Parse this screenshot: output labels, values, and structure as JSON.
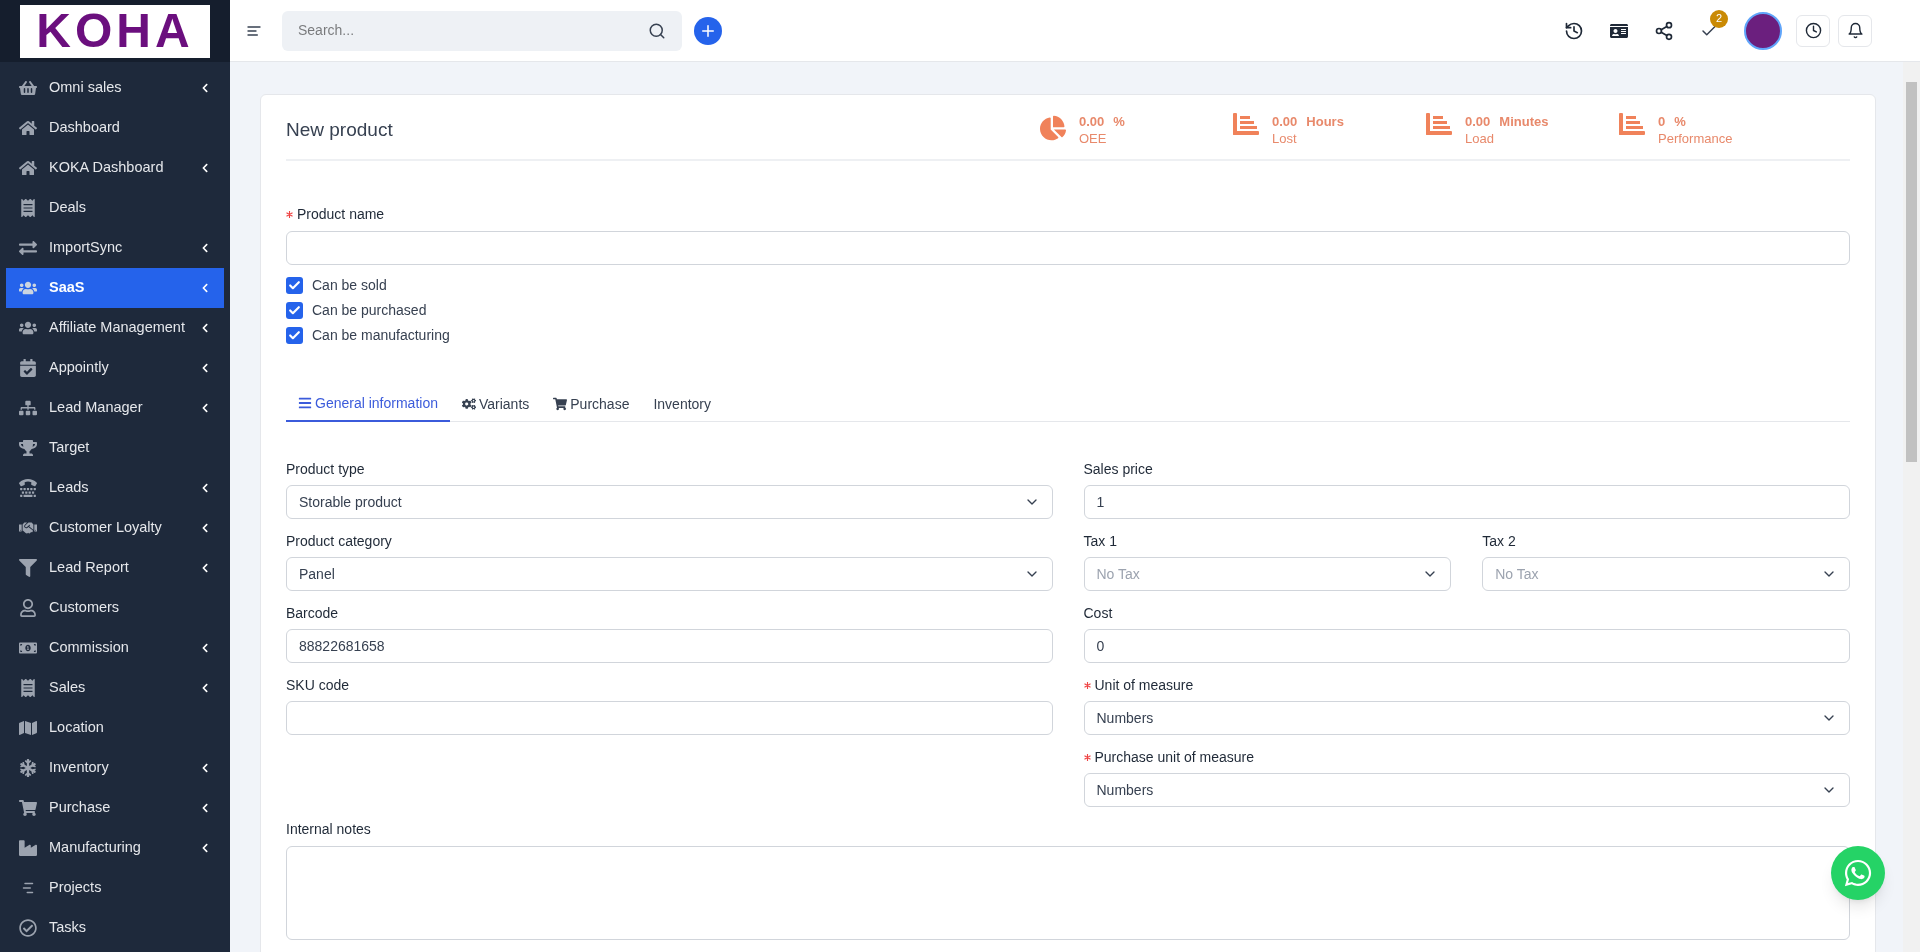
{
  "logo": {
    "text": "KOHA"
  },
  "sidebar": {
    "items": [
      {
        "label": "Omni sales",
        "selected": false,
        "has_submenu": true
      },
      {
        "label": "Dashboard",
        "selected": false,
        "has_submenu": false
      },
      {
        "label": "KOKA Dashboard",
        "selected": false,
        "has_submenu": true
      },
      {
        "label": "Deals",
        "selected": false,
        "has_submenu": false
      },
      {
        "label": "ImportSync",
        "selected": false,
        "has_submenu": true
      },
      {
        "label": "SaaS",
        "selected": true,
        "has_submenu": true
      },
      {
        "label": "Affiliate Management",
        "selected": false,
        "has_submenu": true
      },
      {
        "label": "Appointly",
        "selected": false,
        "has_submenu": true
      },
      {
        "label": "Lead Manager",
        "selected": false,
        "has_submenu": true
      },
      {
        "label": "Target",
        "selected": false,
        "has_submenu": false
      },
      {
        "label": "Leads",
        "selected": false,
        "has_submenu": true
      },
      {
        "label": "Customer Loyalty",
        "selected": false,
        "has_submenu": true
      },
      {
        "label": "Lead Report",
        "selected": false,
        "has_submenu": true
      },
      {
        "label": "Customers",
        "selected": false,
        "has_submenu": false
      },
      {
        "label": "Commission",
        "selected": false,
        "has_submenu": true
      },
      {
        "label": "Sales",
        "selected": false,
        "has_submenu": true
      },
      {
        "label": "Location",
        "selected": false,
        "has_submenu": false
      },
      {
        "label": "Inventory",
        "selected": false,
        "has_submenu": true
      },
      {
        "label": "Purchase",
        "selected": false,
        "has_submenu": true
      },
      {
        "label": "Manufacturing",
        "selected": false,
        "has_submenu": true
      },
      {
        "label": "Projects",
        "selected": false,
        "has_submenu": false
      },
      {
        "label": "Tasks",
        "selected": false,
        "has_submenu": false
      }
    ]
  },
  "topbar": {
    "search": {
      "placeholder": "Search..."
    },
    "tasks_badge": "2"
  },
  "card": {
    "title": "New product",
    "stats": [
      {
        "kind": "pie",
        "value": "0.00",
        "unit": "%",
        "label": "OEE"
      },
      {
        "kind": "bars",
        "value": "0.00",
        "unit": "Hours",
        "label": "Lost"
      },
      {
        "kind": "bars",
        "value": "0.00",
        "unit": "Minutes",
        "label": "Load"
      },
      {
        "kind": "bars",
        "value": "0",
        "unit": "%",
        "label": "Performance"
      }
    ],
    "product_name": {
      "label": "Product name",
      "required": true
    },
    "checkboxes": [
      {
        "label": "Can be sold",
        "checked": true
      },
      {
        "label": "Can be purchased",
        "checked": true
      },
      {
        "label": "Can be manufacturing",
        "checked": true
      }
    ],
    "tabs": [
      {
        "label": "General information",
        "selected": true
      },
      {
        "label": "Variants",
        "selected": false
      },
      {
        "label": "Purchase",
        "selected": false
      },
      {
        "label": "Inventory",
        "selected": false
      }
    ],
    "rows": [
      {
        "left": [
          {
            "label": "Product type",
            "required": false,
            "kind": "select",
            "value": "Storable product"
          }
        ],
        "right": [
          {
            "label": "Sales price",
            "required": false,
            "kind": "input",
            "value": "1"
          }
        ]
      },
      {
        "left": [
          {
            "label": "Product category",
            "required": false,
            "kind": "select",
            "value": "Panel"
          }
        ],
        "right": [
          {
            "label": "Tax 1",
            "required": false,
            "kind": "select",
            "placeholder": "No Tax"
          },
          {
            "label": "Tax 2",
            "required": false,
            "kind": "select",
            "placeholder": "No Tax"
          }
        ]
      },
      {
        "left": [
          {
            "label": "Barcode",
            "required": false,
            "kind": "input",
            "value": "88822681658"
          }
        ],
        "right": [
          {
            "label": "Cost",
            "required": false,
            "kind": "input",
            "value": "0"
          }
        ]
      },
      {
        "left": [
          {
            "label": "SKU code",
            "required": false,
            "kind": "input"
          }
        ],
        "right": [
          {
            "label": "Unit of measure",
            "required": true,
            "kind": "select",
            "value": "Numbers"
          }
        ]
      },
      {
        "left": [],
        "right": [
          {
            "label": "Purchase unit of measure",
            "required": true,
            "kind": "select",
            "value": "Numbers"
          }
        ]
      }
    ],
    "internal_notes": {
      "label": "Internal notes"
    }
  }
}
